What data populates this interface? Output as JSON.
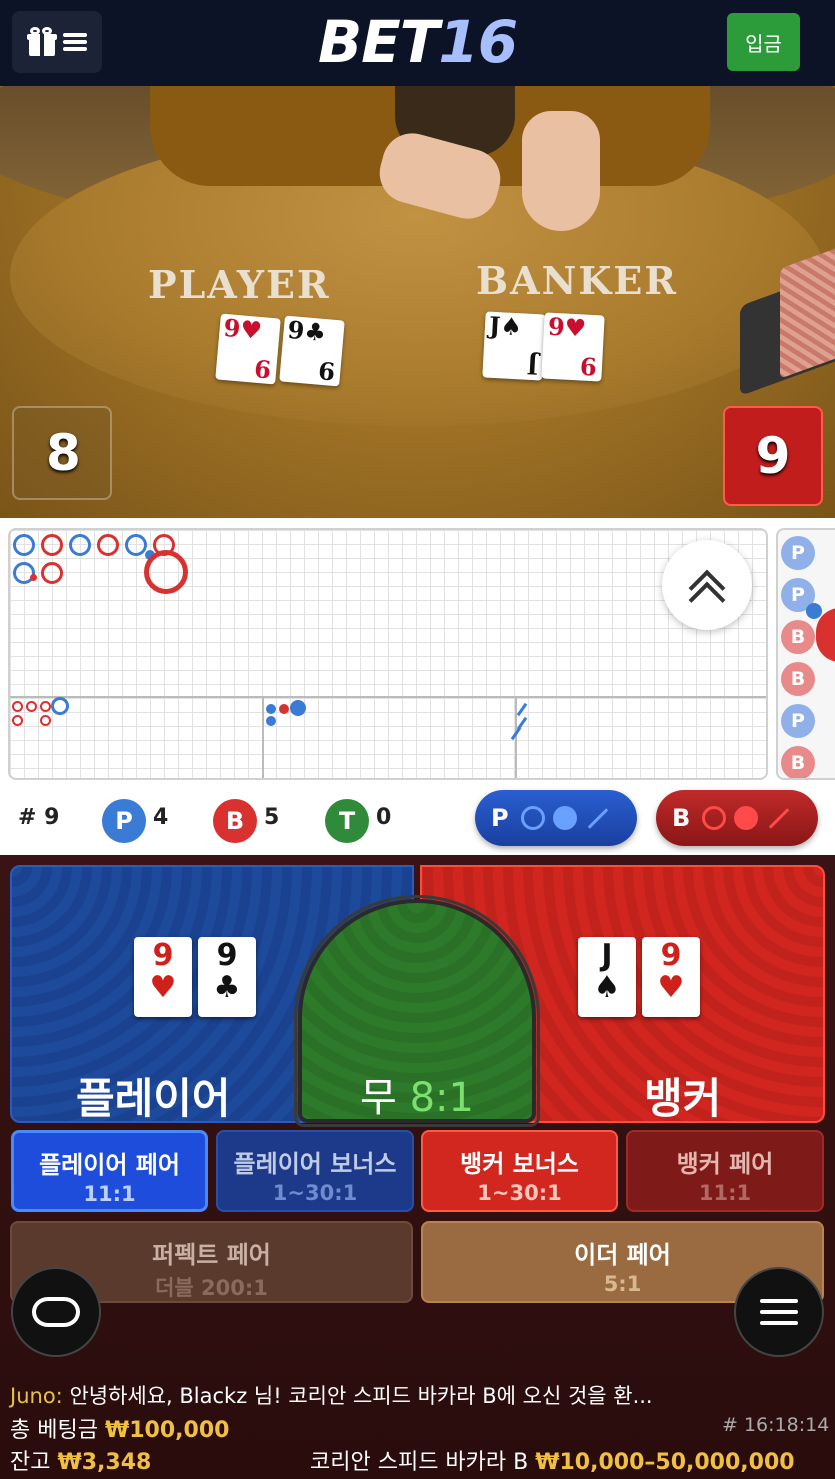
{
  "header": {
    "logo_main": "BET",
    "logo_num": "16",
    "deposit_label": "입금"
  },
  "video": {
    "player_label": "PLAYER",
    "banker_label": "BANKER",
    "player_cards": [
      {
        "rank": "9",
        "suit": "♥",
        "color": "red"
      },
      {
        "rank": "9",
        "suit": "♣",
        "color": "black"
      }
    ],
    "banker_cards": [
      {
        "rank": "J",
        "suit": "♠",
        "color": "black"
      },
      {
        "rank": "9",
        "suit": "♥",
        "color": "red"
      }
    ],
    "player_score": "8",
    "banker_score": "9"
  },
  "roadmap": {
    "bead_road": [
      "P",
      "P",
      "B",
      "B",
      "P",
      "B"
    ],
    "stats": {
      "round_label": "# 9",
      "player_letter": "P",
      "player_count": "4",
      "banker_letter": "B",
      "banker_count": "5",
      "tie_letter": "T",
      "tie_count": "0"
    },
    "predict_player_letter": "P",
    "predict_banker_letter": "B",
    "colors": {
      "player": "#3a7bd5",
      "banker": "#d93030",
      "tie": "#2f8a3a"
    }
  },
  "betting": {
    "player_label": "플레이어",
    "banker_label": "뱅커",
    "tie_label": "무",
    "tie_odds": "8:1",
    "player_cards": [
      {
        "rank": "9",
        "suit": "♥",
        "color": "red"
      },
      {
        "rank": "9",
        "suit": "♣",
        "color": "black"
      }
    ],
    "banker_cards": [
      {
        "rank": "J",
        "suit": "♠",
        "color": "black"
      },
      {
        "rank": "9",
        "suit": "♥",
        "color": "red"
      }
    ],
    "side_bets": [
      {
        "title": "플레이어 페어",
        "odds": "11:1"
      },
      {
        "title": "플레이어 보너스",
        "odds": "1~30:1"
      },
      {
        "title": "뱅커 보너스",
        "odds": "1~30:1"
      },
      {
        "title": "뱅커 페어",
        "odds": "11:1"
      },
      {
        "title": "퍼펙트 페어",
        "odds": "더블 200:1"
      },
      {
        "title": "이더 페어",
        "odds": "5:1"
      }
    ]
  },
  "footer": {
    "chat_user": "Juno:",
    "chat_message": "안녕하세요, Blackz 님! 코리안 스피드 바카라 B에 오신 것을 환...",
    "total_bet_label": "총 베팅금",
    "total_bet_value": "₩100,000",
    "round_time": "# 16:18:14",
    "balance_label": "잔고",
    "balance_value": "₩3,348",
    "table_name": "코리안 스피드 바카라 B",
    "table_limits": "₩10,000–50,000,000"
  }
}
